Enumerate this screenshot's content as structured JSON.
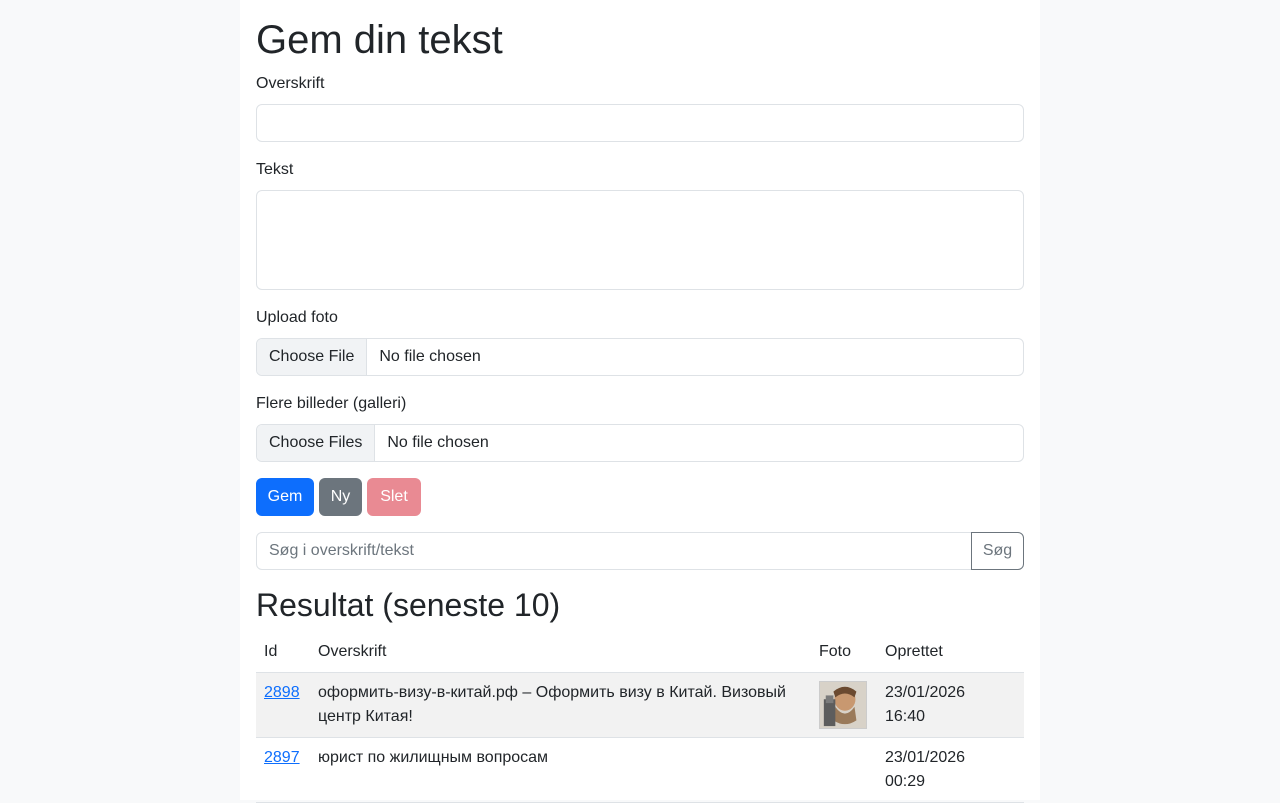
{
  "page": {
    "title": "Gem din tekst"
  },
  "form": {
    "heading_label": "Overskrift",
    "heading_value": "",
    "text_label": "Tekst",
    "text_value": "",
    "upload_label": "Upload foto",
    "upload_button": "Choose File",
    "upload_status": "No file chosen",
    "gallery_label": "Flere billeder (galleri)",
    "gallery_button": "Choose Files",
    "gallery_status": "No file chosen"
  },
  "actions": {
    "save": "Gem",
    "new": "Ny",
    "delete": "Slet"
  },
  "search": {
    "placeholder": "Søg i overskrift/tekst",
    "button": "Søg"
  },
  "results": {
    "title": "Resultat (seneste 10)",
    "columns": [
      "Id",
      "Overskrift",
      "Foto",
      "Oprettet"
    ],
    "rows": [
      {
        "id": "2898",
        "heading": "оформить-визу-в-китай.рф – Оформить визу в Китай. Визовый центр Китая!",
        "has_photo": true,
        "created_date": "23/01/2026",
        "created_time": "16:40"
      },
      {
        "id": "2897",
        "heading": "юрист по жилищным вопросам",
        "has_photo": false,
        "created_date": "23/01/2026",
        "created_time": "00:29"
      }
    ]
  },
  "colors": {
    "primary": "#0d6efd",
    "secondary": "#6c757d",
    "danger_disabled": "#e98a93"
  }
}
